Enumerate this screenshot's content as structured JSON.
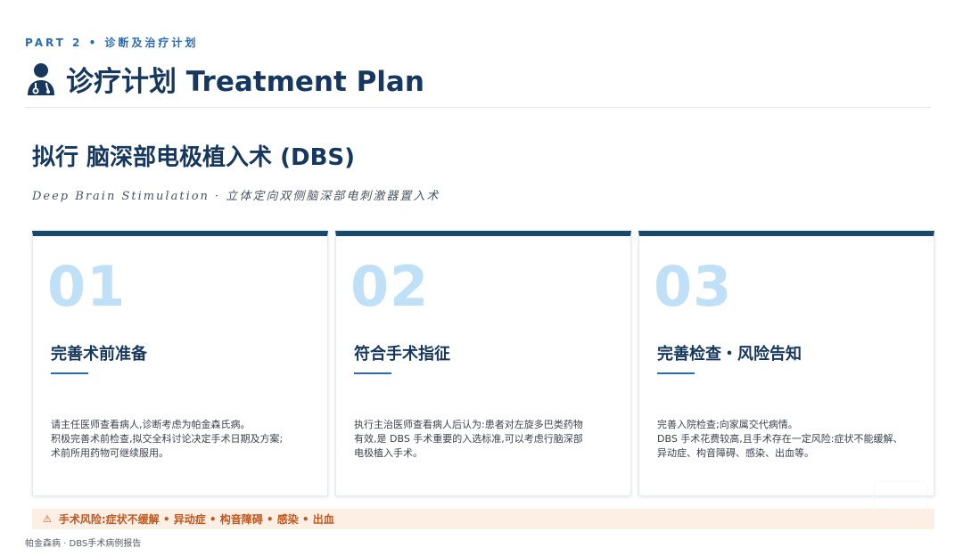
{
  "header": {
    "part_label": "PART 2 • 诊断及治疗计划",
    "title": "诊疗计划 Treatment Plan",
    "icon": "doctor-icon"
  },
  "plan": {
    "title": "拟行  脑深部电极植入术 (DBS)",
    "subtitle": "Deep Brain Stimulation · 立体定向双侧脑深部电刺激器置入术"
  },
  "cards": [
    {
      "number": "01",
      "title": "完善术前准备",
      "lines": [
        "请主任医师查看病人,诊断考虑为帕金森氏病。",
        "积极完善术前检查,拟交全科讨论决定手术日期及方案;",
        "术前所用药物可继续服用。"
      ]
    },
    {
      "number": "02",
      "title": "符合手术指征",
      "lines": [
        "执行主治医师查看病人后认为:患者对左旋多巴类药物",
        "有效,是 DBS 手术重要的入选标准,可以考虑行脑深部",
        "电极植入手术。"
      ]
    },
    {
      "number": "03",
      "title": "完善检查・风险告知",
      "lines": [
        "完善入院检查;向家属交代病情。",
        "DBS 手术花费较高,且手术存在一定风险:症状不能缓解、",
        "异动症、构音障碍、感染、出血等。"
      ]
    }
  ],
  "risk": {
    "icon": "warning-icon",
    "text": "手术风险:症状不缓解 • 异动症 • 构音障碍 • 感染 • 出血"
  },
  "footer": {
    "text": "帕金森病 · DBS手术病例报告"
  },
  "colors": {
    "navy": "#17385e",
    "accent": "#2b6cb0",
    "number": "#bfe0f7",
    "risk_bg": "#fdefe4",
    "risk_text": "#c0571f"
  }
}
